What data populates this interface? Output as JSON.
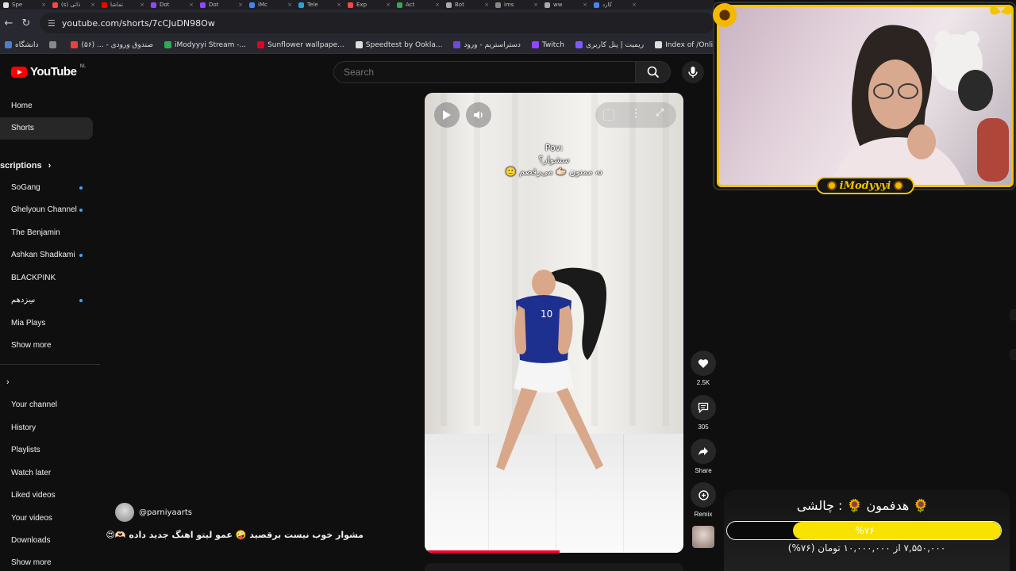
{
  "browser": {
    "tabs": [
      {
        "label": "Spe",
        "color": "#e0e0e0"
      },
      {
        "label": "(s) ذاتی",
        "color": "#ff4444"
      },
      {
        "label": "تماشا",
        "color": "#ff0000"
      },
      {
        "label": "Dot",
        "color": "#9146ff"
      },
      {
        "label": "Dot",
        "color": "#9146ff"
      },
      {
        "label": "iMc",
        "color": "#4285f4"
      },
      {
        "label": "Tele",
        "color": "#2aa1da"
      },
      {
        "label": "Exp",
        "color": "#ff4444"
      },
      {
        "label": "Act",
        "color": "#34a853"
      },
      {
        "label": "Bot",
        "color": "#aaaaaa"
      },
      {
        "label": "ims",
        "color": "#888888"
      },
      {
        "label": "ww",
        "color": "#aaaaaa"
      },
      {
        "label": "کارد",
        "color": "#4285f4"
      }
    ],
    "url": "youtube.com/shorts/7cCJuDN98Ow",
    "bookmarks": [
      {
        "label": "دانشگاه",
        "color": "#4a7fd0"
      },
      {
        "label": "",
        "color": "#888888"
      },
      {
        "label": "صندوق ورودی - ... (۵۶)",
        "color": "#ea4335"
      },
      {
        "label": "iModyyyi Stream -...",
        "color": "#34a853"
      },
      {
        "label": "Sunflower wallpape...",
        "color": "#e60023"
      },
      {
        "label": "Speedtest by Ookla...",
        "color": "#dddddd"
      },
      {
        "label": "دستراستریم - ورود",
        "color": "#6b4bd8"
      },
      {
        "label": "Twitch",
        "color": "#9146ff"
      },
      {
        "label": "ریمیت | پنل کاربری",
        "color": "#7c5cff"
      },
      {
        "label": "Index of /Online/De...",
        "color": "#dddddd"
      }
    ]
  },
  "youtube": {
    "logo_text": "YouTube",
    "region": "NL",
    "search_placeholder": "Search"
  },
  "sidebar": {
    "home": "Home",
    "shorts": "Shorts",
    "subscriptions_header": "scriptions",
    "subscriptions": [
      "SoGang",
      "Ghelyoun Channel",
      "The Benjamin",
      "Ashkan Shadkami",
      "BLACKPINK",
      "سِزدهم",
      "Mia Plays"
    ],
    "show_more_1": "Show more",
    "you": [
      "Your channel",
      "History",
      "Playlists",
      "Watch later",
      "Liked videos",
      "Your videos",
      "Downloads"
    ],
    "show_more_2": "Show more"
  },
  "short": {
    "overlay_line1": "Pov:",
    "overlay_line2": "سشوار؟",
    "overlay_line3": "🙂 نه ممنون 🫱🏻 می‌رقصم",
    "progress_fraction": 0.52,
    "channel_handle": "@parniyaarts",
    "caption": "مشوار خوب نیست برقصید 🤪 عمو لیتو اهنگ جدید داده 🫶🏻😍"
  },
  "actions": {
    "likes": "2.5K",
    "comments": "305",
    "share": "Share",
    "remix": "Remix"
  },
  "stream": {
    "streamer_name": "iModyyyi",
    "goal_title": "🌻 هدفمون 🌻 : چالشی",
    "goal_percent_text": "%۷۶",
    "goal_fraction": 0.76,
    "goal_amount_text": "۷,۵۵۰,۰۰۰ از ۱۰,۰۰۰,۰۰۰ تومان (۷۶%)",
    "accent": "#f5c400",
    "bar_color": "#f7e200"
  }
}
